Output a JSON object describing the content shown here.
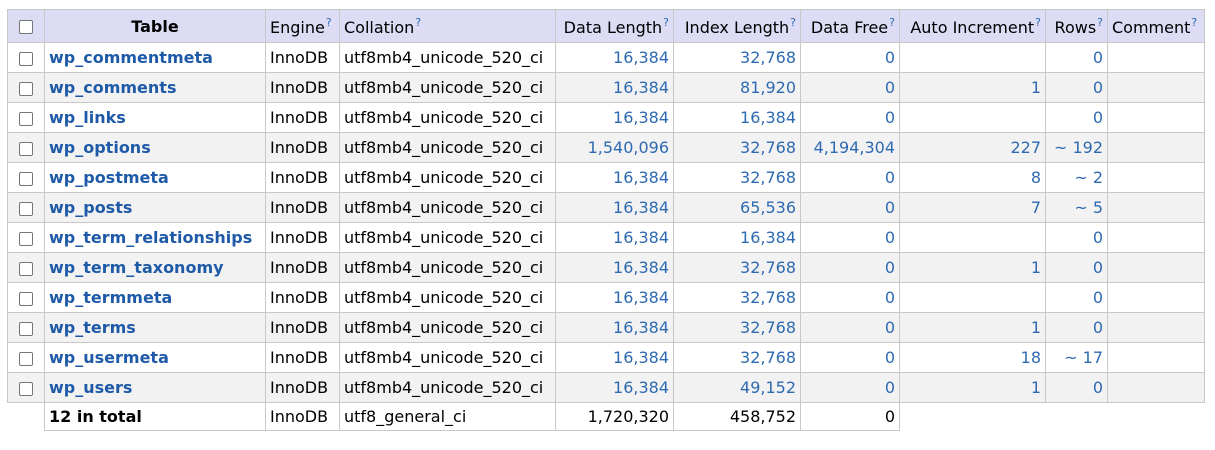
{
  "header": {
    "table": "Table",
    "engine": "Engine",
    "collation": "Collation",
    "data_length": "Data Length",
    "index_length": "Index Length",
    "data_free": "Data Free",
    "auto_increment": "Auto Increment",
    "rows": "Rows",
    "comment": "Comment",
    "help_mark": "?"
  },
  "rows": [
    {
      "name": "wp_commentmeta",
      "engine": "InnoDB",
      "collation": "utf8mb4_unicode_520_ci",
      "data_length": "16,384",
      "index_length": "32,768",
      "data_free": "0",
      "auto_increment": "",
      "rows": "0",
      "comment": ""
    },
    {
      "name": "wp_comments",
      "engine": "InnoDB",
      "collation": "utf8mb4_unicode_520_ci",
      "data_length": "16,384",
      "index_length": "81,920",
      "data_free": "0",
      "auto_increment": "1",
      "rows": "0",
      "comment": ""
    },
    {
      "name": "wp_links",
      "engine": "InnoDB",
      "collation": "utf8mb4_unicode_520_ci",
      "data_length": "16,384",
      "index_length": "16,384",
      "data_free": "0",
      "auto_increment": "",
      "rows": "0",
      "comment": ""
    },
    {
      "name": "wp_options",
      "engine": "InnoDB",
      "collation": "utf8mb4_unicode_520_ci",
      "data_length": "1,540,096",
      "index_length": "32,768",
      "data_free": "4,194,304",
      "auto_increment": "227",
      "rows": "~ 192",
      "comment": ""
    },
    {
      "name": "wp_postmeta",
      "engine": "InnoDB",
      "collation": "utf8mb4_unicode_520_ci",
      "data_length": "16,384",
      "index_length": "32,768",
      "data_free": "0",
      "auto_increment": "8",
      "rows": "~ 2",
      "comment": ""
    },
    {
      "name": "wp_posts",
      "engine": "InnoDB",
      "collation": "utf8mb4_unicode_520_ci",
      "data_length": "16,384",
      "index_length": "65,536",
      "data_free": "0",
      "auto_increment": "7",
      "rows": "~ 5",
      "comment": ""
    },
    {
      "name": "wp_term_relationships",
      "engine": "InnoDB",
      "collation": "utf8mb4_unicode_520_ci",
      "data_length": "16,384",
      "index_length": "16,384",
      "data_free": "0",
      "auto_increment": "",
      "rows": "0",
      "comment": ""
    },
    {
      "name": "wp_term_taxonomy",
      "engine": "InnoDB",
      "collation": "utf8mb4_unicode_520_ci",
      "data_length": "16,384",
      "index_length": "32,768",
      "data_free": "0",
      "auto_increment": "1",
      "rows": "0",
      "comment": ""
    },
    {
      "name": "wp_termmeta",
      "engine": "InnoDB",
      "collation": "utf8mb4_unicode_520_ci",
      "data_length": "16,384",
      "index_length": "32,768",
      "data_free": "0",
      "auto_increment": "",
      "rows": "0",
      "comment": ""
    },
    {
      "name": "wp_terms",
      "engine": "InnoDB",
      "collation": "utf8mb4_unicode_520_ci",
      "data_length": "16,384",
      "index_length": "32,768",
      "data_free": "0",
      "auto_increment": "1",
      "rows": "0",
      "comment": ""
    },
    {
      "name": "wp_usermeta",
      "engine": "InnoDB",
      "collation": "utf8mb4_unicode_520_ci",
      "data_length": "16,384",
      "index_length": "32,768",
      "data_free": "0",
      "auto_increment": "18",
      "rows": "~ 17",
      "comment": ""
    },
    {
      "name": "wp_users",
      "engine": "InnoDB",
      "collation": "utf8mb4_unicode_520_ci",
      "data_length": "16,384",
      "index_length": "49,152",
      "data_free": "0",
      "auto_increment": "1",
      "rows": "0",
      "comment": ""
    }
  ],
  "footer": {
    "total_label": "12 in total",
    "engine": "InnoDB",
    "collation": "utf8_general_ci",
    "data_length": "1,720,320",
    "index_length": "458,752",
    "data_free": "0"
  },
  "colors": {
    "header_bg": "#dcdcf4",
    "link": "#1e5aa8",
    "number_link": "#2e6ab1",
    "row_alt_bg": "#f2f2f2",
    "border": "#c8c8c8"
  }
}
